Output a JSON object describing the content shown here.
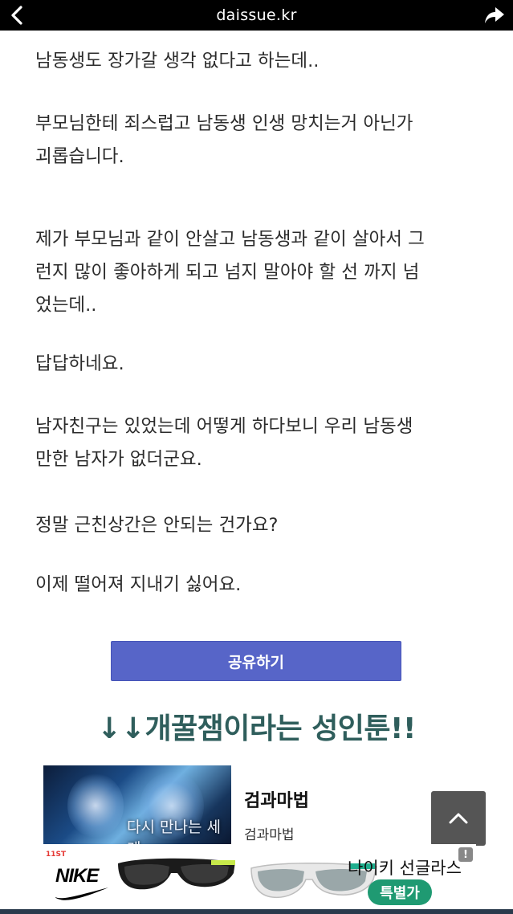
{
  "browser": {
    "url": "daissue.kr"
  },
  "article": {
    "paragraphs": [
      "남동생도 장가갈 생각 없다고 하는데..",
      "부모님한테 죄스럽고 남동생 인생 망치는거 아닌가\n괴롭습니다.",
      "제가 부모님과 같이 안살고 남동생과 같이 살아서 그\n런지 많이 좋아하게 되고 넘지 말아야 할 선 까지 넘\n었는데..",
      "답답하네요.",
      "남자친구는 있었는데 어떻게 하다보니 우리 남동생\n만한 남자가 없더군요.",
      "정말 근친상간은 안되는 건가요?",
      "이제 떨어져 지내기 싫어요."
    ]
  },
  "share_button": {
    "label": "공유하기"
  },
  "promo": {
    "title": "↓↓개꿀잼이라는 성인툰!!"
  },
  "card": {
    "thumb_caption": "다시 만나는 세계",
    "title": "검과마법",
    "subtitle": "검과마법"
  },
  "ad": {
    "brand": "NIKE",
    "store_badge": "11ST",
    "title": "나이키 선글라스",
    "price_label": "특별가",
    "info_icon": "!"
  },
  "icons": {
    "back": "chevron-left-icon",
    "share": "share-arrow-icon",
    "scroll_top": "chevron-up-icon"
  },
  "colors": {
    "topbar": "#000000",
    "share_button": "#5765c8",
    "promo_title": "#2f5e5c",
    "ad_price": "#1f9a72"
  }
}
